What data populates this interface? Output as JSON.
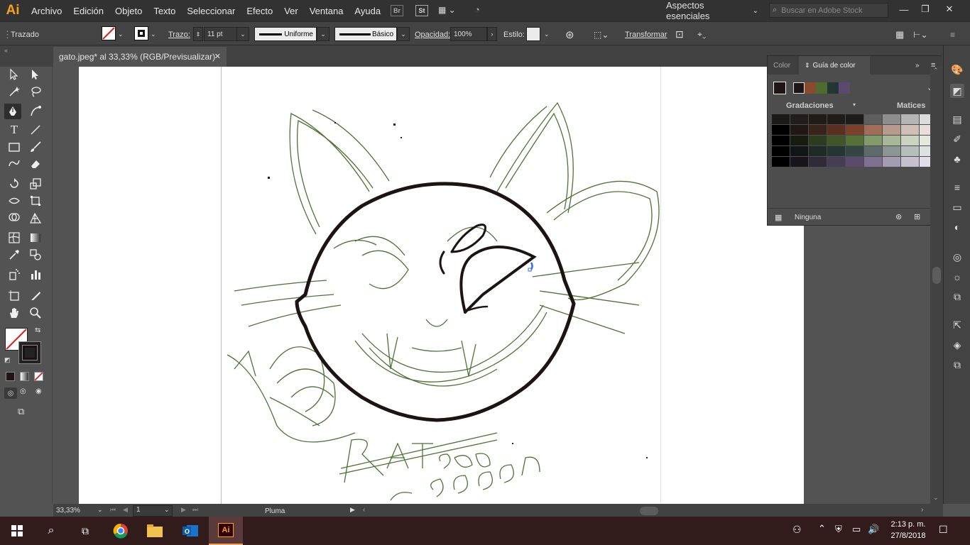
{
  "app": {
    "logo": "Ai",
    "menus": [
      "Archivo",
      "Edición",
      "Objeto",
      "Texto",
      "Seleccionar",
      "Efecto",
      "Ver",
      "Ventana",
      "Ayuda"
    ],
    "workspace": "Aspectos esenciales",
    "search_placeholder": "Buscar en Adobe Stock",
    "bridge_label": "Br",
    "stock_label": "St"
  },
  "control_bar": {
    "selection_label": "Trazado",
    "stroke_label": "Trazo:",
    "stroke_weight": "11 pt",
    "profile_label": "Uniforme",
    "brush_label": "Básico",
    "opacity_label": "Opacidad:",
    "opacity_value": "100%",
    "style_label": "Estilo:",
    "transform_label": "Transformar"
  },
  "document": {
    "tab_title": "gato.jpeg* al 33,33% (RGB/Previsualizar)"
  },
  "panel": {
    "tab_color": "Color",
    "tab_guide": "Guía de color",
    "gradations_label": "Gradaciones",
    "shades_label": "Matices",
    "footer_label": "Ninguna",
    "harmony_colors": [
      "#1e1614",
      "#8a4a2e",
      "#4f6b30",
      "#253533",
      "#5a4a6c"
    ],
    "grid_colors": [
      [
        "#1c1a18",
        "#221c1a",
        "#211c18",
        "#1f1c1a",
        "#1e1c1a",
        "#5e5e5e",
        "#8e8e8e",
        "#b5b5b5",
        "#dcdcdc"
      ],
      [
        "#000000",
        "#201815",
        "#3a231b",
        "#59301f",
        "#7a402a",
        "#a06d58",
        "#b89a8c",
        "#d0bfb8",
        "#e8dfdc"
      ],
      [
        "#000000",
        "#161c10",
        "#2d3b1f",
        "#405528",
        "#567035",
        "#849a6a",
        "#a6b895",
        "#c9d3bf",
        "#e3e9dd"
      ],
      [
        "#000000",
        "#101615",
        "#1e2928",
        "#253533",
        "#354544",
        "#5d6c6b",
        "#8b9695",
        "#b6bdbd",
        "#dee2e2"
      ],
      [
        "#000000",
        "#17151b",
        "#2e2a36",
        "#463d54",
        "#5a4a6c",
        "#7f7290",
        "#a59cb2",
        "#c6c0cf",
        "#e3dfe9"
      ]
    ]
  },
  "status_bar": {
    "zoom": "33,33%",
    "artboard_number": "1",
    "tool_name": "Pluma"
  },
  "taskbar": {
    "time": "2:13 p. m.",
    "date": "27/8/2018"
  }
}
